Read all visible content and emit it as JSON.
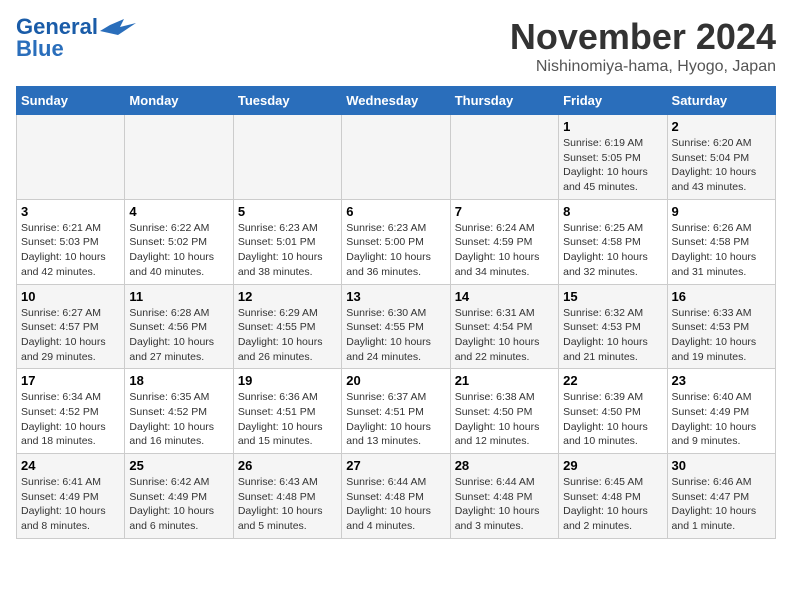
{
  "header": {
    "logo_line1": "General",
    "logo_line2": "Blue",
    "title": "November 2024",
    "subtitle": "Nishinomiya-hama, Hyogo, Japan"
  },
  "weekdays": [
    "Sunday",
    "Monday",
    "Tuesday",
    "Wednesday",
    "Thursday",
    "Friday",
    "Saturday"
  ],
  "weeks": [
    [
      {
        "day": "",
        "detail": ""
      },
      {
        "day": "",
        "detail": ""
      },
      {
        "day": "",
        "detail": ""
      },
      {
        "day": "",
        "detail": ""
      },
      {
        "day": "",
        "detail": ""
      },
      {
        "day": "1",
        "detail": "Sunrise: 6:19 AM\nSunset: 5:05 PM\nDaylight: 10 hours and 45 minutes."
      },
      {
        "day": "2",
        "detail": "Sunrise: 6:20 AM\nSunset: 5:04 PM\nDaylight: 10 hours and 43 minutes."
      }
    ],
    [
      {
        "day": "3",
        "detail": "Sunrise: 6:21 AM\nSunset: 5:03 PM\nDaylight: 10 hours and 42 minutes."
      },
      {
        "day": "4",
        "detail": "Sunrise: 6:22 AM\nSunset: 5:02 PM\nDaylight: 10 hours and 40 minutes."
      },
      {
        "day": "5",
        "detail": "Sunrise: 6:23 AM\nSunset: 5:01 PM\nDaylight: 10 hours and 38 minutes."
      },
      {
        "day": "6",
        "detail": "Sunrise: 6:23 AM\nSunset: 5:00 PM\nDaylight: 10 hours and 36 minutes."
      },
      {
        "day": "7",
        "detail": "Sunrise: 6:24 AM\nSunset: 4:59 PM\nDaylight: 10 hours and 34 minutes."
      },
      {
        "day": "8",
        "detail": "Sunrise: 6:25 AM\nSunset: 4:58 PM\nDaylight: 10 hours and 32 minutes."
      },
      {
        "day": "9",
        "detail": "Sunrise: 6:26 AM\nSunset: 4:58 PM\nDaylight: 10 hours and 31 minutes."
      }
    ],
    [
      {
        "day": "10",
        "detail": "Sunrise: 6:27 AM\nSunset: 4:57 PM\nDaylight: 10 hours and 29 minutes."
      },
      {
        "day": "11",
        "detail": "Sunrise: 6:28 AM\nSunset: 4:56 PM\nDaylight: 10 hours and 27 minutes."
      },
      {
        "day": "12",
        "detail": "Sunrise: 6:29 AM\nSunset: 4:55 PM\nDaylight: 10 hours and 26 minutes."
      },
      {
        "day": "13",
        "detail": "Sunrise: 6:30 AM\nSunset: 4:55 PM\nDaylight: 10 hours and 24 minutes."
      },
      {
        "day": "14",
        "detail": "Sunrise: 6:31 AM\nSunset: 4:54 PM\nDaylight: 10 hours and 22 minutes."
      },
      {
        "day": "15",
        "detail": "Sunrise: 6:32 AM\nSunset: 4:53 PM\nDaylight: 10 hours and 21 minutes."
      },
      {
        "day": "16",
        "detail": "Sunrise: 6:33 AM\nSunset: 4:53 PM\nDaylight: 10 hours and 19 minutes."
      }
    ],
    [
      {
        "day": "17",
        "detail": "Sunrise: 6:34 AM\nSunset: 4:52 PM\nDaylight: 10 hours and 18 minutes."
      },
      {
        "day": "18",
        "detail": "Sunrise: 6:35 AM\nSunset: 4:52 PM\nDaylight: 10 hours and 16 minutes."
      },
      {
        "day": "19",
        "detail": "Sunrise: 6:36 AM\nSunset: 4:51 PM\nDaylight: 10 hours and 15 minutes."
      },
      {
        "day": "20",
        "detail": "Sunrise: 6:37 AM\nSunset: 4:51 PM\nDaylight: 10 hours and 13 minutes."
      },
      {
        "day": "21",
        "detail": "Sunrise: 6:38 AM\nSunset: 4:50 PM\nDaylight: 10 hours and 12 minutes."
      },
      {
        "day": "22",
        "detail": "Sunrise: 6:39 AM\nSunset: 4:50 PM\nDaylight: 10 hours and 10 minutes."
      },
      {
        "day": "23",
        "detail": "Sunrise: 6:40 AM\nSunset: 4:49 PM\nDaylight: 10 hours and 9 minutes."
      }
    ],
    [
      {
        "day": "24",
        "detail": "Sunrise: 6:41 AM\nSunset: 4:49 PM\nDaylight: 10 hours and 8 minutes."
      },
      {
        "day": "25",
        "detail": "Sunrise: 6:42 AM\nSunset: 4:49 PM\nDaylight: 10 hours and 6 minutes."
      },
      {
        "day": "26",
        "detail": "Sunrise: 6:43 AM\nSunset: 4:48 PM\nDaylight: 10 hours and 5 minutes."
      },
      {
        "day": "27",
        "detail": "Sunrise: 6:44 AM\nSunset: 4:48 PM\nDaylight: 10 hours and 4 minutes."
      },
      {
        "day": "28",
        "detail": "Sunrise: 6:44 AM\nSunset: 4:48 PM\nDaylight: 10 hours and 3 minutes."
      },
      {
        "day": "29",
        "detail": "Sunrise: 6:45 AM\nSunset: 4:48 PM\nDaylight: 10 hours and 2 minutes."
      },
      {
        "day": "30",
        "detail": "Sunrise: 6:46 AM\nSunset: 4:47 PM\nDaylight: 10 hours and 1 minute."
      }
    ]
  ]
}
